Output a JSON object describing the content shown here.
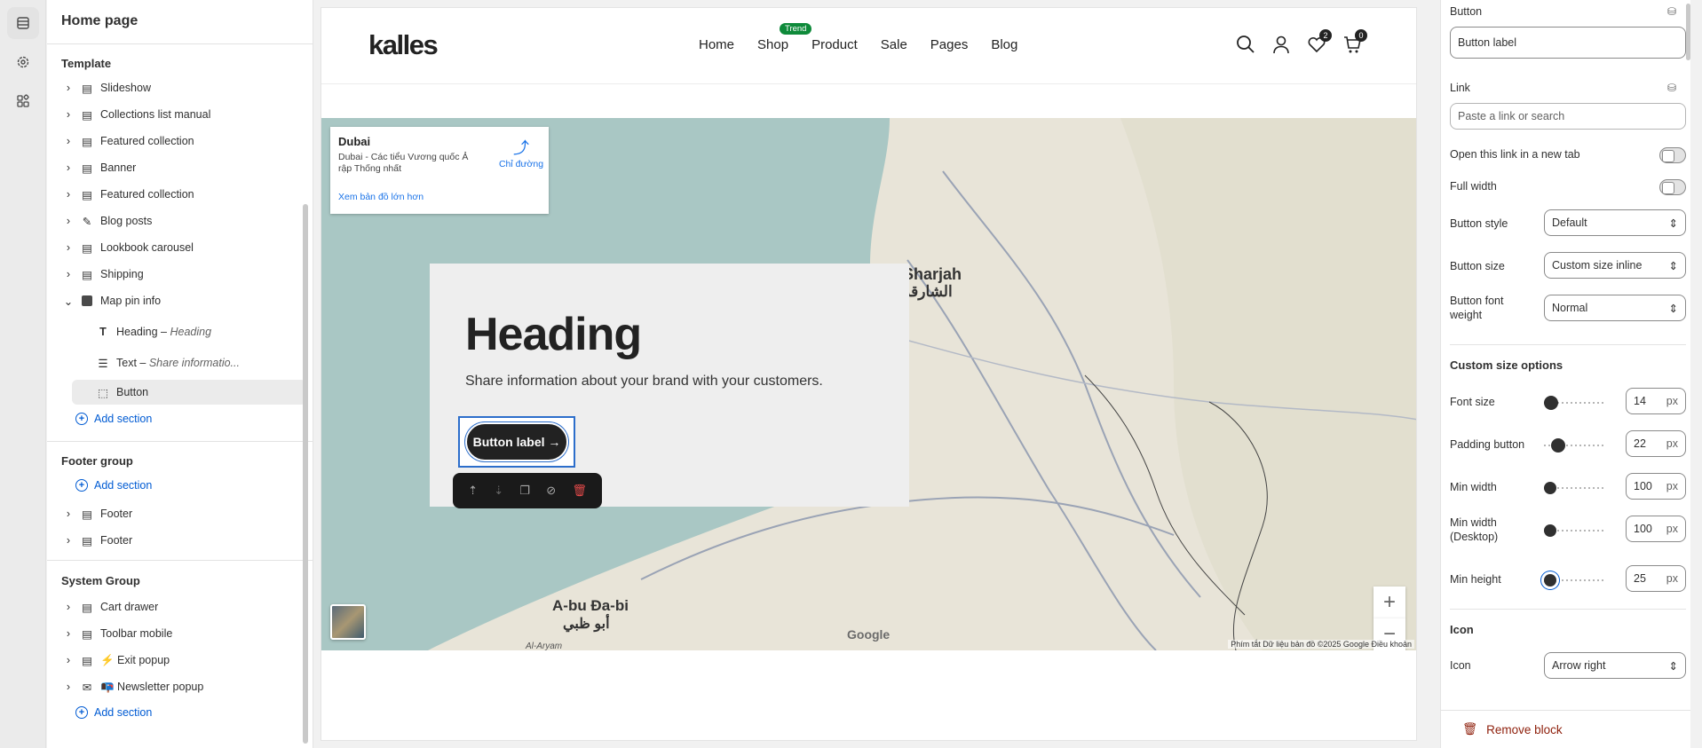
{
  "left": {
    "title": "Home page",
    "template": {
      "title": "Template",
      "items": [
        {
          "label": "Slideshow"
        },
        {
          "label": "Collections list manual"
        },
        {
          "label": "Featured collection"
        },
        {
          "label": "Banner"
        },
        {
          "label": "Featured collection"
        },
        {
          "label": "Blog posts"
        },
        {
          "label": "Lookbook carousel"
        },
        {
          "label": "Shipping"
        },
        {
          "label": "Map pin info"
        }
      ],
      "children": [
        {
          "label": "Heading",
          "detail": "Heading"
        },
        {
          "label": "Text",
          "detail": "Share informatio..."
        },
        {
          "label": "Button"
        }
      ],
      "add": "Add section"
    },
    "footer": {
      "title": "Footer group",
      "add": "Add section",
      "items": [
        {
          "label": "Footer"
        },
        {
          "label": "Footer"
        }
      ]
    },
    "system": {
      "title": "System Group",
      "items": [
        {
          "label": "Cart drawer"
        },
        {
          "label": "Toolbar mobile"
        },
        {
          "label": "⚡ Exit popup"
        },
        {
          "label": "📭 Newsletter popup"
        }
      ],
      "add": "Add section"
    }
  },
  "site": {
    "logo": "kalles",
    "nav": [
      "Home",
      "Shop",
      "Product",
      "Sale",
      "Pages",
      "Blog"
    ],
    "trend": "Trend",
    "wishlist_count": "2",
    "cart_count": "0",
    "map_info": {
      "name": "Dubai",
      "address": "Dubai - Các tiểu Vương quốc Ả rập Thống nhất",
      "directions": "Chỉ đường",
      "bigger": "Xem bản đồ lớn hơn"
    },
    "hero": {
      "heading": "Heading",
      "text": "Share information about your brand with your customers.",
      "button": "Button label →"
    },
    "map_labels": {
      "sharjah": "Sharjah",
      "sharjah_ar": "الشارقة",
      "abudhabi": "A-bu Đa-bi",
      "abudhabi_ar": "أبو ظبي",
      "alaryam": "Al-Aryam",
      "google": "Google",
      "attribution": "Phím tắt   Dữ liệu bản đồ ©2025 Google   Điều khoản"
    }
  },
  "right": {
    "button_label": "Button",
    "button_value": "Button label",
    "link_label": "Link",
    "link_placeholder": "Paste a link or search",
    "new_tab": "Open this link in a new tab",
    "full_width": "Full width",
    "style_label": "Button style",
    "style_value": "Default",
    "size_label": "Button size",
    "size_value": "Custom size inline",
    "weight_label": "Button font weight",
    "weight_value": "Normal",
    "custom_title": "Custom size options",
    "font_size": {
      "label": "Font size",
      "value": "14",
      "unit": "px"
    },
    "padding": {
      "label": "Padding button",
      "value": "22",
      "unit": "px"
    },
    "min_width": {
      "label": "Min width",
      "value": "100",
      "unit": "px"
    },
    "min_width_desktop": {
      "label": "Min width (Desktop)",
      "value": "100",
      "unit": "px"
    },
    "min_height": {
      "label": "Min height",
      "value": "25",
      "unit": "px"
    },
    "icon_title": "Icon",
    "icon_label": "Icon",
    "icon_value": "Arrow right",
    "remove": "Remove block"
  },
  "colors": {
    "accent": "#005bd3",
    "danger": "#8e1f0b",
    "trend": "#0e8a3a"
  }
}
